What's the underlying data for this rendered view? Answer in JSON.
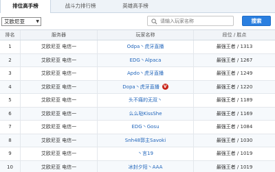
{
  "tabs": [
    {
      "label": "排位高手榜"
    },
    {
      "label": "战斗力排行榜"
    },
    {
      "label": "英雄高手榜"
    }
  ],
  "server_select": {
    "value": "艾欧尼亚"
  },
  "search": {
    "placeholder": "请输入玩家名称",
    "button_label": "搜索"
  },
  "table": {
    "headers": {
      "rank": "排名",
      "server": "服务器",
      "name": "玩家名称",
      "tier": "段位 / 胜点"
    },
    "rows": [
      {
        "rank": "1",
        "server": "艾欧尼亚 电信一",
        "name": "Odpa丶虎牙直播",
        "tier": "最强王者 / 1313"
      },
      {
        "rank": "2",
        "server": "艾欧尼亚 电信一",
        "name": "EDG丶Alpaca",
        "tier": "最强王者 / 1267"
      },
      {
        "rank": "3",
        "server": "艾欧尼亚 电信一",
        "name": "Apdo丶虎牙直播",
        "tier": "最强王者 / 1249"
      },
      {
        "rank": "4",
        "server": "艾欧尼亚 电信一",
        "name": "Dopa丶虎牙直播",
        "tier": "最强王者 / 1220",
        "badge": "V"
      },
      {
        "rank": "5",
        "server": "艾欧尼亚 电信一",
        "name": "头不痛的无双丶",
        "tier": "最强王者 / 1189"
      },
      {
        "rank": "6",
        "server": "艾欧尼亚 电信一",
        "name": "么么哒KissShe",
        "tier": "最强王者 / 1169"
      },
      {
        "rank": "7",
        "server": "艾欧尼亚 电信一",
        "name": "EDG丶Gosu",
        "tier": "最强王者 / 1084"
      },
      {
        "rank": "8",
        "server": "艾欧尼亚 电信一",
        "name": "Snh48郭主Savoki",
        "tier": "最强王者 / 1030"
      },
      {
        "rank": "9",
        "server": "艾欧尼亚 电信一",
        "name": "丶言19",
        "tier": "最强王者 / 1019"
      },
      {
        "rank": "10",
        "server": "艾欧尼亚 电信一",
        "name": "冰封夕阳丶AAA",
        "tier": "最强王者 / 1019"
      }
    ]
  },
  "colors": {
    "accent": "#2a7fe0",
    "link": "#2266bb",
    "badge": "#c9261b"
  }
}
